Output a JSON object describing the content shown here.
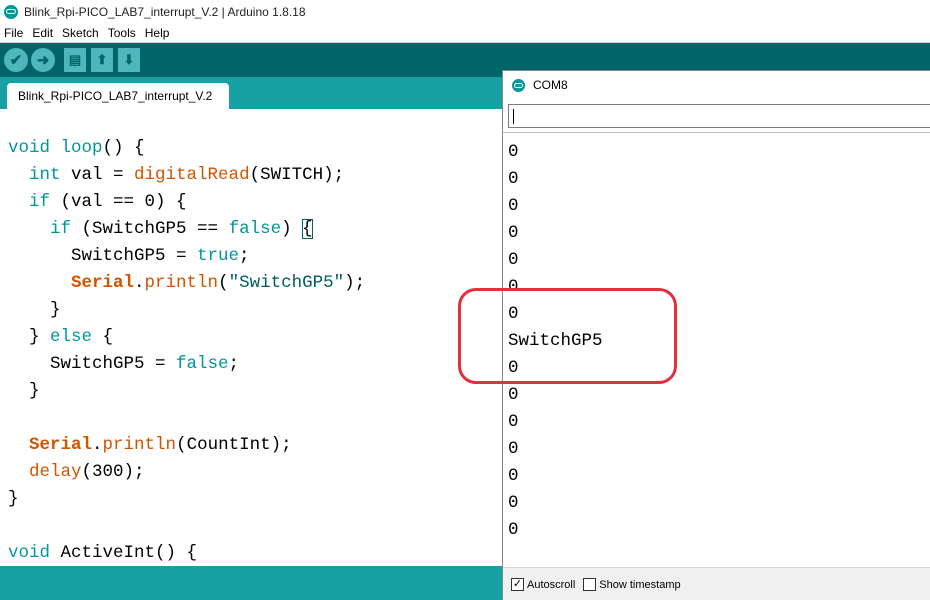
{
  "window": {
    "title": "Blink_Rpi-PICO_LAB7_interrupt_V.2 | Arduino 1.8.18"
  },
  "menu": [
    "File",
    "Edit",
    "Sketch",
    "Tools",
    "Help"
  ],
  "toolbar": {
    "verify_icon": "check-icon",
    "upload_icon": "arrow-right-icon",
    "new_icon": "new-file-icon",
    "open_icon": "arrow-up-icon",
    "save_icon": "arrow-down-icon"
  },
  "tab": {
    "label": "Blink_Rpi-PICO_LAB7_interrupt_V.2"
  },
  "editor": {
    "lines": [
      [
        {
          "t": "void",
          "c": "kw"
        },
        {
          "t": " "
        },
        {
          "t": "loop",
          "c": "kw"
        },
        {
          "t": "() {"
        }
      ],
      [
        {
          "t": "  "
        },
        {
          "t": "int",
          "c": "kw"
        },
        {
          "t": " val = "
        },
        {
          "t": "digitalRead",
          "c": "fn"
        },
        {
          "t": "(SWITCH);"
        }
      ],
      [
        {
          "t": "  "
        },
        {
          "t": "if",
          "c": "kw"
        },
        {
          "t": " (val == 0) {"
        }
      ],
      [
        {
          "t": "    "
        },
        {
          "t": "if",
          "c": "kw"
        },
        {
          "t": " (SwitchGP5 == "
        },
        {
          "t": "false",
          "c": "kw"
        },
        {
          "t": ") "
        },
        {
          "t": "{",
          "c": "bracematch"
        }
      ],
      [
        {
          "t": "      SwitchGP5 = "
        },
        {
          "t": "true",
          "c": "kw"
        },
        {
          "t": ";"
        }
      ],
      [
        {
          "t": "      "
        },
        {
          "t": "Serial",
          "c": "ser"
        },
        {
          "t": "."
        },
        {
          "t": "println",
          "c": "fn"
        },
        {
          "t": "("
        },
        {
          "t": "\"SwitchGP5\"",
          "c": "str"
        },
        {
          "t": ");"
        }
      ],
      [
        {
          "t": "    }"
        }
      ],
      [
        {
          "t": "  } "
        },
        {
          "t": "else",
          "c": "kw"
        },
        {
          "t": " {"
        }
      ],
      [
        {
          "t": "    SwitchGP5 = "
        },
        {
          "t": "false",
          "c": "kw"
        },
        {
          "t": ";"
        }
      ],
      [
        {
          "t": "  }"
        }
      ],
      [
        {
          "t": ""
        }
      ],
      [
        {
          "t": "  "
        },
        {
          "t": "Serial",
          "c": "ser"
        },
        {
          "t": "."
        },
        {
          "t": "println",
          "c": "fn"
        },
        {
          "t": "(CountInt);"
        }
      ],
      [
        {
          "t": "  "
        },
        {
          "t": "delay",
          "c": "fn"
        },
        {
          "t": "(300);"
        }
      ],
      [
        {
          "t": "}"
        }
      ],
      [
        {
          "t": ""
        }
      ],
      [
        {
          "t": "void",
          "c": "kw"
        },
        {
          "t": " ActiveInt() {"
        }
      ]
    ]
  },
  "serial_monitor": {
    "title": "COM8",
    "input_value": "",
    "output": [
      "0",
      "0",
      "0",
      "0",
      "0",
      "0",
      "0",
      "SwitchGP5",
      "0",
      "0",
      "0",
      "0",
      "0",
      "0",
      "0"
    ],
    "autoscroll_label": "Autoscroll",
    "autoscroll_checked": true,
    "timestamp_label": "Show timestamp",
    "timestamp_checked": false
  },
  "colors": {
    "toolbar": "#006468",
    "tabstrip": "#17a1a5",
    "keyword": "#00979c",
    "function": "#d35400",
    "string": "#005c5f",
    "annotation": "#e0303a"
  }
}
